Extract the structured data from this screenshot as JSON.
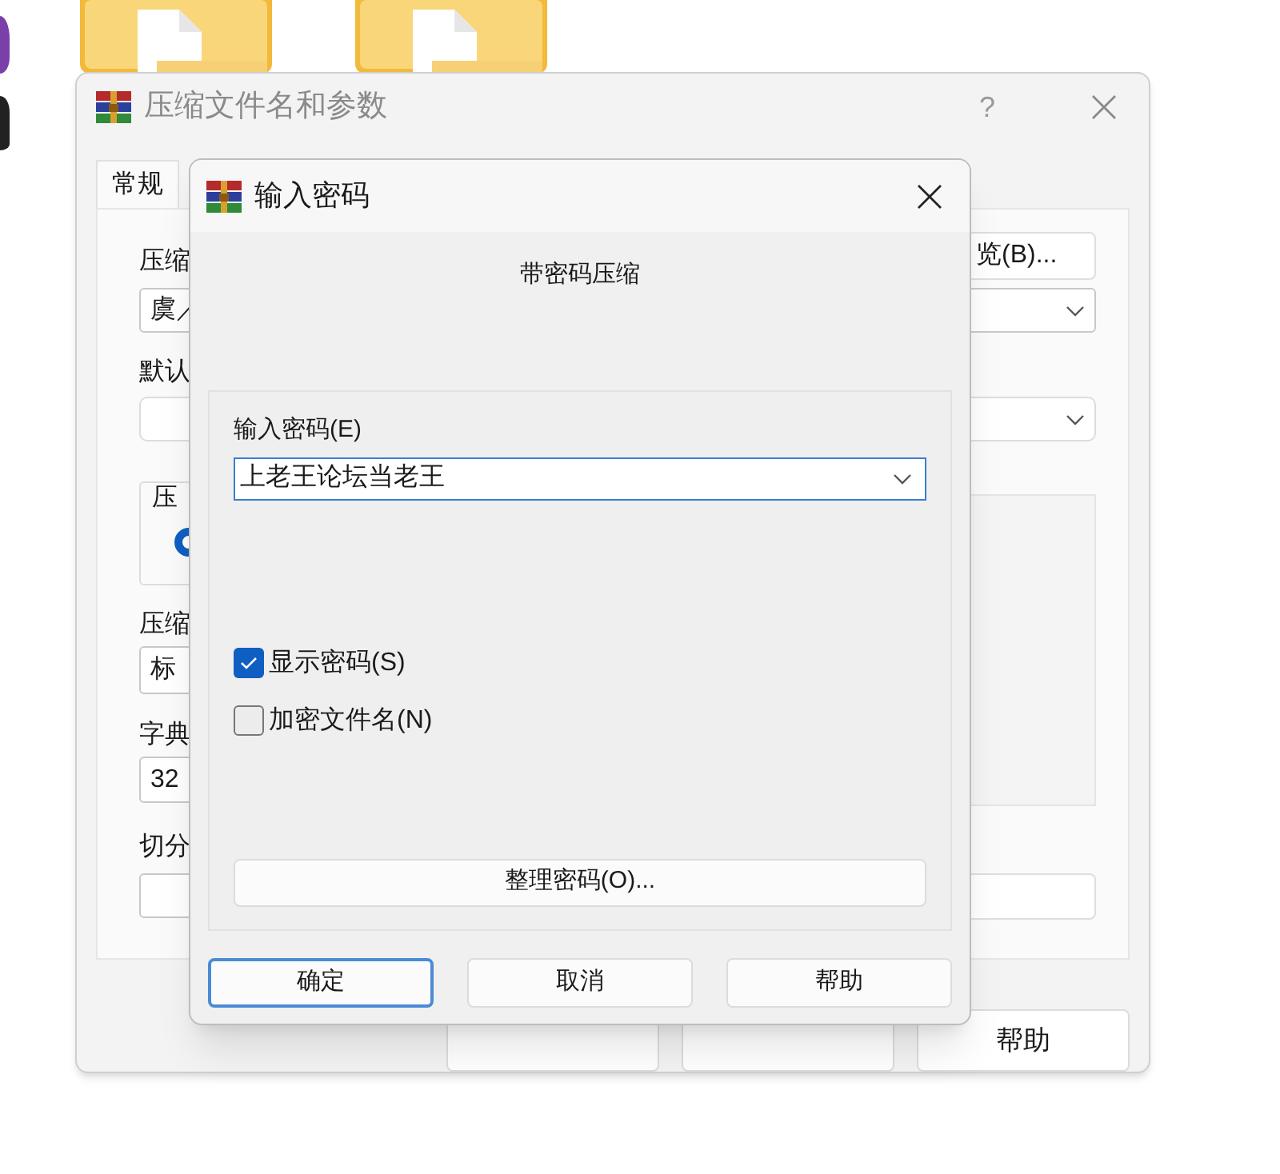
{
  "archive_window": {
    "title": "压缩文件名和参数",
    "help": "?",
    "tabs": [
      {
        "label": "常规",
        "selected": true
      }
    ],
    "archive_name": {
      "label": "压缩",
      "value": "虞／"
    },
    "browse_button": "览(B)...",
    "default_profile": {
      "label": "默认"
    },
    "format_group": {
      "label": "压",
      "option_selected": true
    },
    "method": {
      "label": "压缩",
      "value": "标"
    },
    "dictionary": {
      "label": "字典",
      "value": "32"
    },
    "split": {
      "label": "切分"
    },
    "buttons": [
      {
        "label": "帮助"
      }
    ]
  },
  "password_dialog": {
    "title": "输入密码",
    "heading": "带密码压缩",
    "password_label": "输入密码(E)",
    "password_value": "上老王论坛当老王",
    "checkboxes": [
      {
        "label": "显示密码(S)",
        "checked": true
      },
      {
        "label": "加密文件名(N)",
        "checked": false
      }
    ],
    "organize_button": "整理密码(O)...",
    "buttons": [
      {
        "label": "确定",
        "default": true
      },
      {
        "label": "取消",
        "default": false
      },
      {
        "label": "帮助",
        "default": false
      }
    ]
  }
}
